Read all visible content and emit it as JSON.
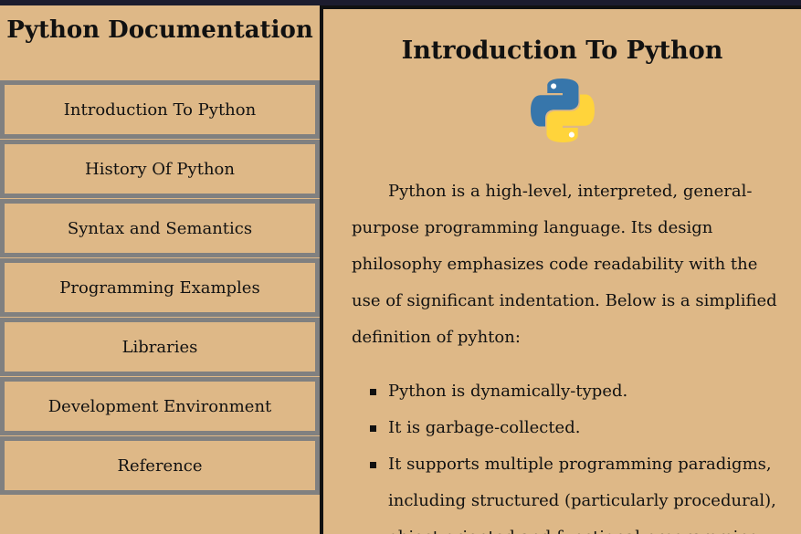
{
  "navbar": {
    "title": "Python Documentation",
    "links": [
      {
        "label": "Introduction To Python"
      },
      {
        "label": "History Of Python"
      },
      {
        "label": "Syntax and Semantics"
      },
      {
        "label": "Programming Examples"
      },
      {
        "label": "Libraries"
      },
      {
        "label": "Development Environment"
      },
      {
        "label": "Reference"
      }
    ]
  },
  "main": {
    "section_title": "Introduction To Python",
    "logo_icon": "python-logo-icon",
    "paragraph": "Python is a high-level, interpreted, general-purpose programming language. Its design philosophy emphasizes code readability with the use of significant indentation. Below is a simplified definition of pyhton:",
    "list": [
      "Python is dynamically-typed.",
      "It is garbage-collected.",
      "It supports multiple programming paradigms, including structured (particularly procedural), object-oriented and functional programming."
    ]
  },
  "colors": {
    "background": "#deb887",
    "border": "#808080",
    "dark": "#1c1c2e",
    "python_blue": "#3776ab",
    "python_yellow": "#ffd43b"
  }
}
